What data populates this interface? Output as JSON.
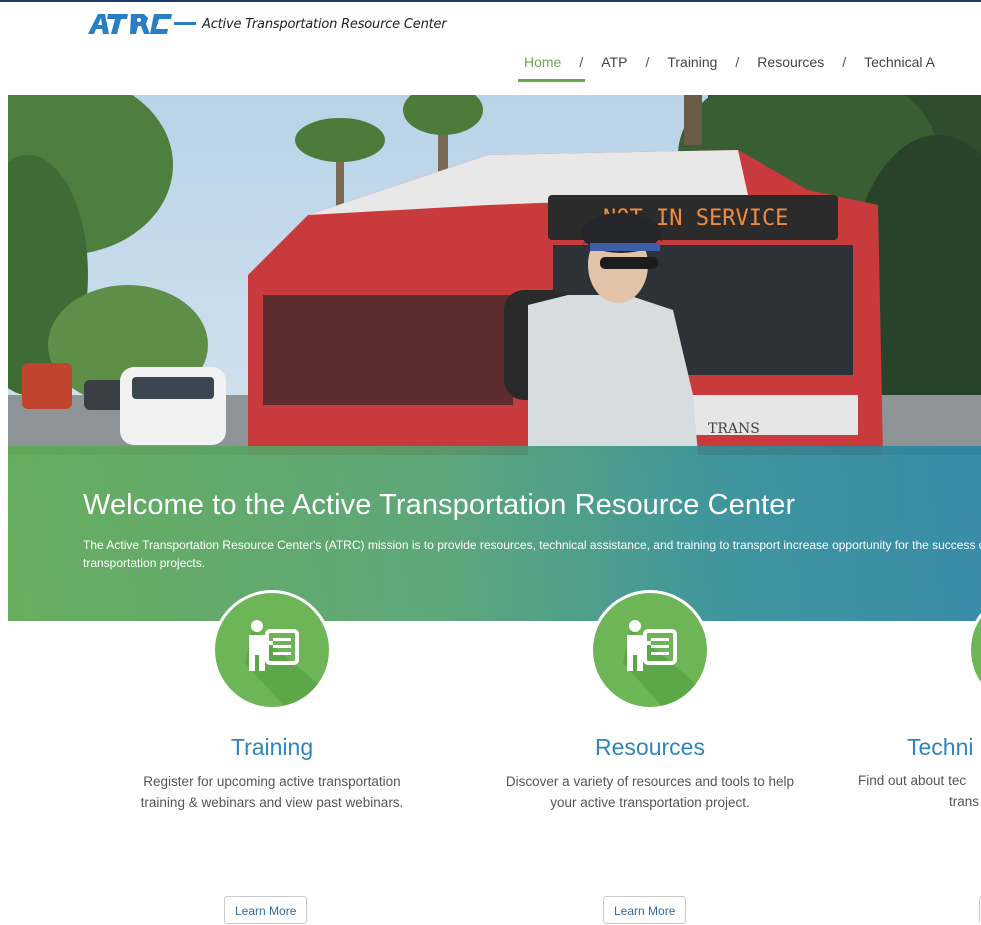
{
  "brand": {
    "logo_text": "Active Transportation Resource Center"
  },
  "nav": {
    "items": [
      {
        "label": "Home",
        "active": true
      },
      {
        "label": "ATP"
      },
      {
        "label": "Training"
      },
      {
        "label": "Resources"
      },
      {
        "label": "Technical A"
      }
    ],
    "separator": "/"
  },
  "hero": {
    "sign_text": "NOT IN SERVICE",
    "bus_text": "TRANS",
    "title": "Welcome to the Active Transportation Resource Center",
    "description": "The Active Transportation Resource Center's (ATRC) mission is to provide resources, technical assistance, and training to transport increase opportunity for the success of active transportation projects."
  },
  "cards": [
    {
      "title": "Training",
      "desc_line1": "Register for upcoming active transportation",
      "desc_line2": "training & webinars and view past webinars.",
      "button": "Learn More"
    },
    {
      "title": "Resources",
      "desc_line1": "Discover a variety of resources and tools to help",
      "desc_line2": "your active transportation project.",
      "button": "Learn More"
    },
    {
      "title": "Techni",
      "desc_line1": "Find out about tec",
      "desc_line2": "trans"
    }
  ],
  "colors": {
    "accent_green": "#6aa84f",
    "link_blue": "#2e86c1",
    "icon_green": "#6db556"
  },
  "icons": [
    "presenter-board-icon"
  ]
}
